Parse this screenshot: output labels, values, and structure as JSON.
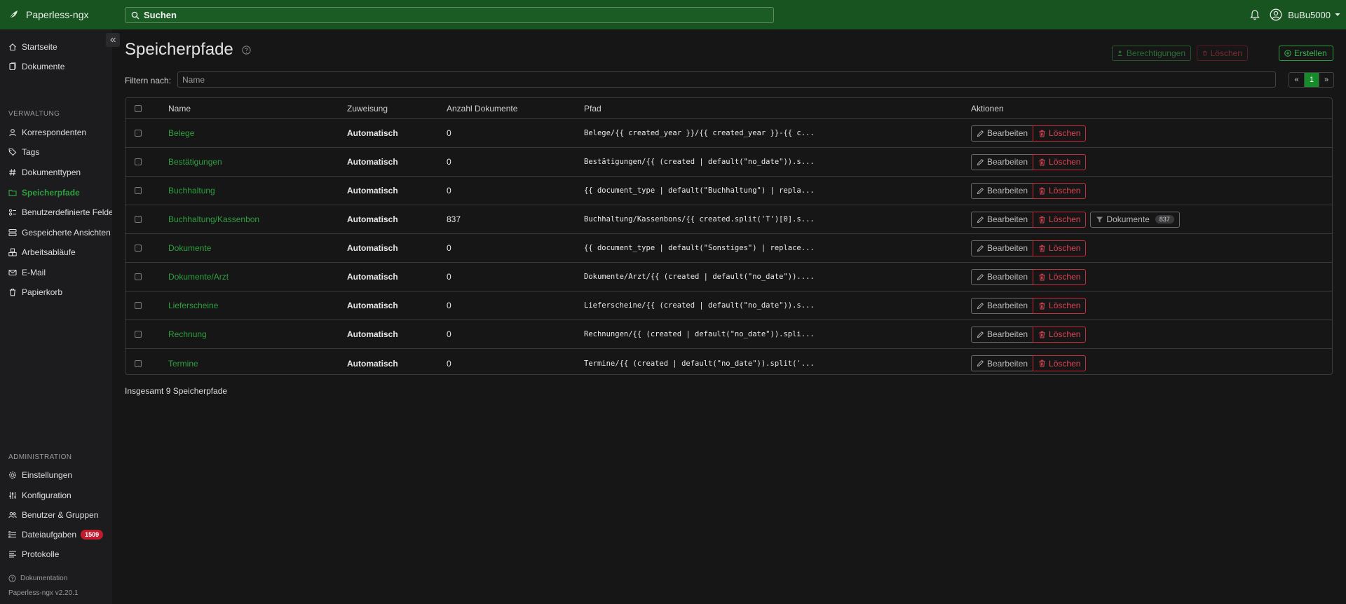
{
  "app": {
    "name": "Paperless-ngx"
  },
  "search": {
    "placeholder": "Suchen"
  },
  "user": {
    "name": "BuBu5000"
  },
  "sidebar": {
    "items_top": [
      {
        "label": "Startseite",
        "icon": "house-icon"
      },
      {
        "label": "Dokumente",
        "icon": "files-icon"
      }
    ],
    "verwaltung_heading": "VERWALTUNG",
    "items_verwaltung": [
      {
        "label": "Korrespondenten",
        "icon": "person-icon"
      },
      {
        "label": "Tags",
        "icon": "tags-icon"
      },
      {
        "label": "Dokumenttypen",
        "icon": "hash-icon"
      },
      {
        "label": "Speicherpfade",
        "icon": "folder-icon",
        "active": true
      },
      {
        "label": "Benutzerdefinierte Felder",
        "icon": "ui-radios-icon"
      },
      {
        "label": "Gespeicherte Ansichten",
        "icon": "view-list-icon"
      },
      {
        "label": "Arbeitsabläufe",
        "icon": "boxes-icon"
      },
      {
        "label": "E-Mail",
        "icon": "envelope-icon"
      },
      {
        "label": "Papierkorb",
        "icon": "trash-icon"
      }
    ],
    "administration_heading": "ADMINISTRATION",
    "items_admin": [
      {
        "label": "Einstellungen",
        "icon": "gear-icon"
      },
      {
        "label": "Konfiguration",
        "icon": "sliders-icon"
      },
      {
        "label": "Benutzer & Gruppen",
        "icon": "people-icon"
      },
      {
        "label": "Dateiaufgaben",
        "icon": "list-task-icon",
        "badge": "1509"
      },
      {
        "label": "Protokolle",
        "icon": "text-left-icon"
      }
    ],
    "doc_link": "Dokumentation",
    "version": "Paperless-ngx v2.20.1"
  },
  "page": {
    "title": "Speicherpfade",
    "btn_permissions": "Berechtigungen",
    "btn_delete": "Löschen",
    "btn_create": "Erstellen",
    "filter_label": "Filtern nach:",
    "filter_placeholder": "Name",
    "pager": {
      "prev": "«",
      "current": "1",
      "next": "»"
    },
    "total": "Insgesamt 9 Speicherpfade"
  },
  "table": {
    "headers": {
      "name": "Name",
      "zuweisung": "Zuweisung",
      "anzahl": "Anzahl Dokumente",
      "pfad": "Pfad",
      "aktionen": "Aktionen"
    },
    "edit_label": "Bearbeiten",
    "delete_label": "Löschen",
    "docs_label": "Dokumente",
    "rows": [
      {
        "name": "Belege",
        "zuweisung": "Automatisch",
        "anzahl": "0",
        "pfad": "Belege/{{ created_year }}/{{ created_year }}-{{ c..."
      },
      {
        "name": "Bestätigungen",
        "zuweisung": "Automatisch",
        "anzahl": "0",
        "pfad": "Bestätigungen/{{ (created | default(\"no_date\")).s..."
      },
      {
        "name": "Buchhaltung",
        "zuweisung": "Automatisch",
        "anzahl": "0",
        "pfad": "{{ document_type | default(\"Buchhaltung\") | repla..."
      },
      {
        "name": "Buchhaltung/Kassenbon",
        "zuweisung": "Automatisch",
        "anzahl": "837",
        "pfad": "Buchhaltung/Kassenbons/{{ created.split('T')[0].s...",
        "docs_count": "837"
      },
      {
        "name": "Dokumente",
        "zuweisung": "Automatisch",
        "anzahl": "0",
        "pfad": "{{ document_type | default(\"Sonstiges\") | replace..."
      },
      {
        "name": "Dokumente/Arzt",
        "zuweisung": "Automatisch",
        "anzahl": "0",
        "pfad": "Dokumente/Arzt/{{ (created | default(\"no_date\"))...."
      },
      {
        "name": "Lieferscheine",
        "zuweisung": "Automatisch",
        "anzahl": "0",
        "pfad": "Lieferscheine/{{ (created | default(\"no_date\")).s..."
      },
      {
        "name": "Rechnung",
        "zuweisung": "Automatisch",
        "anzahl": "0",
        "pfad": "Rechnungen/{{ (created | default(\"no_date\")).spli..."
      },
      {
        "name": "Termine",
        "zuweisung": "Automatisch",
        "anzahl": "0",
        "pfad": "Termine/{{ (created | default(\"no_date\")).split('..."
      }
    ]
  },
  "colors": {
    "header_bg": "#17541f",
    "accent": "#2f9e3f",
    "danger": "#dc4452",
    "background": "#161617",
    "sidebar_bg": "#1c1c1e"
  }
}
